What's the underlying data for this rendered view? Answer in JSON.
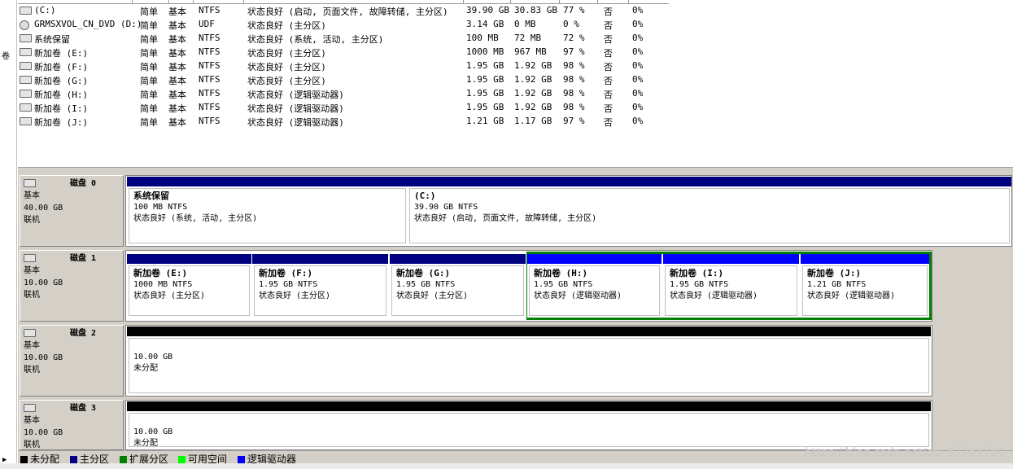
{
  "left_strip": {
    "mark": "卷",
    "arrow": "▶"
  },
  "volumes": [
    {
      "icon": "drive-icon",
      "name": "(C:)",
      "layout": "简单",
      "type": "基本",
      "fs": "NTFS",
      "status": "状态良好 (启动, 页面文件, 故障转储, 主分区)",
      "capacity": "39.90 GB",
      "free": "30.83 GB",
      "pct_free": "77 %",
      "fault_tolerance": "否",
      "overhead": "0%"
    },
    {
      "icon": "cd-icon",
      "name": "GRMSXVOL_CN_DVD (D:)",
      "layout": "简单",
      "type": "基本",
      "fs": "UDF",
      "status": "状态良好 (主分区)",
      "capacity": "3.14 GB",
      "free": "0 MB",
      "pct_free": "0 %",
      "fault_tolerance": "否",
      "overhead": "0%"
    },
    {
      "icon": "drive-icon",
      "name": "系统保留",
      "layout": "简单",
      "type": "基本",
      "fs": "NTFS",
      "status": "状态良好 (系统, 活动, 主分区)",
      "capacity": "100 MB",
      "free": "72 MB",
      "pct_free": "72 %",
      "fault_tolerance": "否",
      "overhead": "0%"
    },
    {
      "icon": "drive-icon",
      "name": "新加卷 (E:)",
      "layout": "简单",
      "type": "基本",
      "fs": "NTFS",
      "status": "状态良好 (主分区)",
      "capacity": "1000 MB",
      "free": "967 MB",
      "pct_free": "97 %",
      "fault_tolerance": "否",
      "overhead": "0%"
    },
    {
      "icon": "drive-icon",
      "name": "新加卷 (F:)",
      "layout": "简单",
      "type": "基本",
      "fs": "NTFS",
      "status": "状态良好 (主分区)",
      "capacity": "1.95 GB",
      "free": "1.92 GB",
      "pct_free": "98 %",
      "fault_tolerance": "否",
      "overhead": "0%"
    },
    {
      "icon": "drive-icon",
      "name": "新加卷 (G:)",
      "layout": "简单",
      "type": "基本",
      "fs": "NTFS",
      "status": "状态良好 (主分区)",
      "capacity": "1.95 GB",
      "free": "1.92 GB",
      "pct_free": "98 %",
      "fault_tolerance": "否",
      "overhead": "0%"
    },
    {
      "icon": "drive-icon",
      "name": "新加卷 (H:)",
      "layout": "简单",
      "type": "基本",
      "fs": "NTFS",
      "status": "状态良好 (逻辑驱动器)",
      "capacity": "1.95 GB",
      "free": "1.92 GB",
      "pct_free": "98 %",
      "fault_tolerance": "否",
      "overhead": "0%"
    },
    {
      "icon": "drive-icon",
      "name": "新加卷 (I:)",
      "layout": "简单",
      "type": "基本",
      "fs": "NTFS",
      "status": "状态良好 (逻辑驱动器)",
      "capacity": "1.95 GB",
      "free": "1.92 GB",
      "pct_free": "98 %",
      "fault_tolerance": "否",
      "overhead": "0%"
    },
    {
      "icon": "drive-icon",
      "name": "新加卷 (J:)",
      "layout": "简单",
      "type": "基本",
      "fs": "NTFS",
      "status": "状态良好 (逻辑驱动器)",
      "capacity": "1.21 GB",
      "free": "1.17 GB",
      "pct_free": "97 %",
      "fault_tolerance": "否",
      "overhead": "0%"
    }
  ],
  "disks": [
    {
      "title": "磁盘 0",
      "kind": "基本",
      "size": "40.00 GB",
      "state": "联机",
      "partitions": [
        {
          "bar": "primary",
          "name": "系统保留",
          "size": "100 MB NTFS",
          "status": "状态良好 (系统, 活动, 主分区)"
        },
        {
          "bar": "primary",
          "name": "(C:)",
          "size": "39.90 GB NTFS",
          "status": "状态良好 (启动, 页面文件, 故障转储, 主分区)"
        }
      ]
    },
    {
      "title": "磁盘 1",
      "kind": "基本",
      "size": "10.00 GB",
      "state": "联机",
      "partitions": [
        {
          "bar": "primary",
          "name": "新加卷  (E:)",
          "size": "1000 MB NTFS",
          "status": "状态良好 (主分区)"
        },
        {
          "bar": "primary",
          "name": "新加卷  (F:)",
          "size": "1.95 GB NTFS",
          "status": "状态良好 (主分区)"
        },
        {
          "bar": "primary",
          "name": "新加卷  (G:)",
          "size": "1.95 GB NTFS",
          "status": "状态良好 (主分区)"
        },
        {
          "bar": "logical",
          "name": "新加卷  (H:)",
          "size": "1.95 GB NTFS",
          "status": "状态良好 (逻辑驱动器)"
        },
        {
          "bar": "logical",
          "name": "新加卷  (I:)",
          "size": "1.95 GB NTFS",
          "status": "状态良好 (逻辑驱动器)"
        },
        {
          "bar": "logical",
          "name": "新加卷  (J:)",
          "size": "1.21 GB NTFS",
          "status": "状态良好 (逻辑驱动器)"
        }
      ]
    },
    {
      "title": "磁盘 2",
      "kind": "基本",
      "size": "10.00 GB",
      "state": "联机",
      "partitions": [
        {
          "bar": "unalloc",
          "name": "",
          "size": "10.00 GB",
          "status": "未分配"
        }
      ]
    },
    {
      "title": "磁盘 3",
      "kind": "基本",
      "size": "10.00 GB",
      "state": "联机",
      "partitions": [
        {
          "bar": "unalloc",
          "name": "",
          "size": "10.00 GB",
          "status": "未分配"
        }
      ]
    }
  ],
  "legend": [
    {
      "color": "#000000",
      "label": "未分配"
    },
    {
      "color": "#000080",
      "label": "主分区"
    },
    {
      "color": "#008000",
      "label": "扩展分区"
    },
    {
      "color": "#00ff00",
      "label": "可用空间"
    },
    {
      "color": "#0000ff",
      "label": "逻辑驱动器"
    }
  ],
  "colors": {
    "primary": "#000080",
    "logical": "#0000ff",
    "unalloc": "#000000",
    "extended": "#008000"
  },
  "watermark": "https://blog.csdn.net/qq_37763760"
}
